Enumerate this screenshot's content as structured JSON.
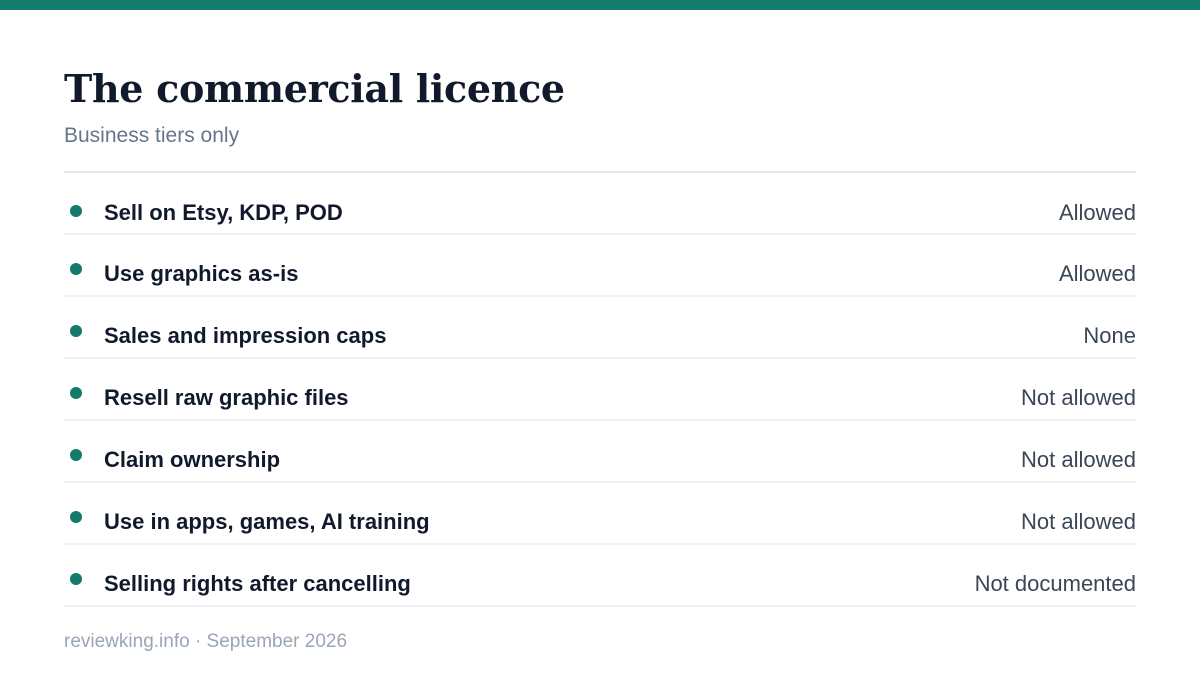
{
  "header": {
    "title": "The commercial licence",
    "subtitle": "Business tiers only"
  },
  "rows": [
    {
      "feature": "Sell on Etsy, KDP, POD",
      "status": "Allowed"
    },
    {
      "feature": "Use graphics as-is",
      "status": "Allowed"
    },
    {
      "feature": "Sales and impression caps",
      "status": "None"
    },
    {
      "feature": "Resell raw graphic files",
      "status": "Not allowed"
    },
    {
      "feature": "Claim ownership",
      "status": "Not allowed"
    },
    {
      "feature": "Use in apps, games, AI training",
      "status": "Not allowed"
    },
    {
      "feature": "Selling rights after cancelling",
      "status": "Not documented"
    }
  ],
  "footer": {
    "text": "reviewking.info · September 2026"
  },
  "colors": {
    "accent": "#137a6c",
    "title": "#111a2c",
    "subtitle": "#66768b",
    "status": "#3a4655",
    "footer": "#9aa6b4"
  },
  "icons": {
    "bullet": "bullet-dot-icon"
  }
}
